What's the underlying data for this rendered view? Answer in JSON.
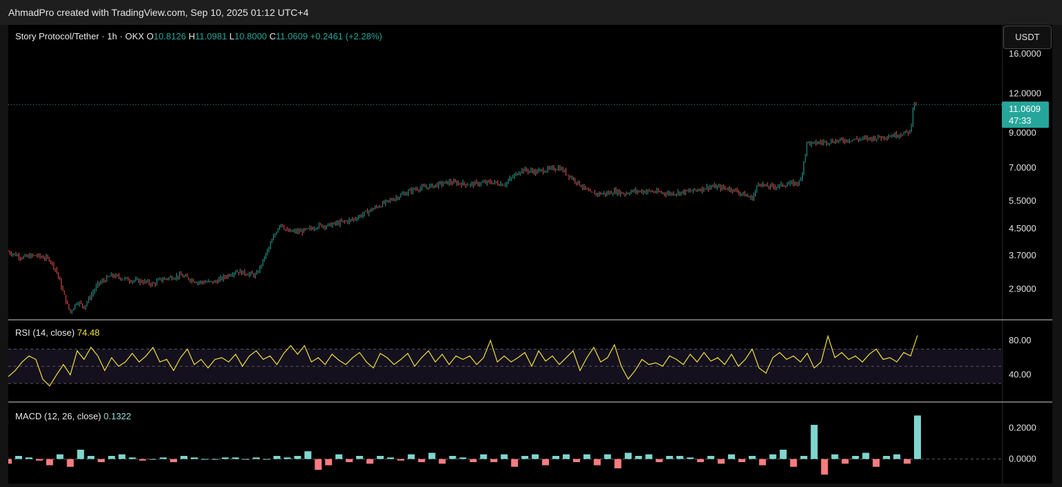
{
  "header": {
    "attribution": "AhmadPro created with TradingView.com, Sep 10, 2025 01:12 UTC+4"
  },
  "symbol": {
    "name": "Story Protocol/Tether · 1h · OKX",
    "open_label": "O",
    "open": "10.8126",
    "high_label": "H",
    "high": "11.0981",
    "low_label": "L",
    "low": "10.8000",
    "close_label": "C",
    "close": "11.0609",
    "change": "+0.2461 (+2.28%)"
  },
  "currency_button": "USDT",
  "last_price": {
    "value": "11.0609",
    "countdown": "47:33"
  },
  "colors": {
    "up": "#26a69a",
    "down": "#ef5350",
    "rsi": "#f5e13a",
    "hist_up": "#7fd6cf",
    "hist_down": "#f77c80"
  },
  "chart_data": [
    {
      "type": "line",
      "title": "Story Protocol/Tether · 1h · OKX",
      "scale": "log",
      "y_ticks": [
        "16.0000",
        "12.0000",
        "9.0000",
        "7.0000",
        "5.5000",
        "4.5000",
        "3.7000",
        "2.9000"
      ],
      "ylim": [
        2.4,
        17
      ],
      "x": [
        0,
        20,
        40,
        60,
        70,
        85,
        90,
        100,
        110,
        130,
        150,
        175,
        200,
        210,
        220,
        250,
        275,
        300,
        330,
        360,
        395,
        405,
        425,
        440,
        450,
        465,
        500,
        530,
        560,
        590,
        610,
        640,
        670,
        700,
        720,
        745,
        765,
        800,
        830,
        845,
        870,
        880,
        895,
        905,
        930,
        960,
        990,
        1020,
        1050,
        1080,
        1090,
        1100,
        1110,
        1130,
        1150,
        1160,
        1165,
        1175,
        1200,
        1230,
        1260,
        1290,
        1300,
        1310,
        1314,
        1320
      ],
      "values": [
        3.8,
        3.65,
        3.7,
        3.6,
        3.3,
        2.6,
        2.45,
        2.65,
        2.55,
        3.0,
        3.2,
        3.1,
        3.05,
        3.0,
        3.1,
        3.2,
        3.05,
        3.05,
        3.3,
        3.2,
        4.7,
        4.4,
        4.4,
        4.5,
        4.6,
        4.6,
        4.8,
        5.2,
        5.6,
        6.0,
        6.1,
        6.3,
        6.2,
        6.3,
        6.2,
        6.9,
        6.8,
        7.0,
        6.2,
        5.8,
        5.8,
        5.9,
        5.8,
        5.9,
        5.9,
        5.8,
        5.9,
        6.1,
        6.0,
        5.6,
        6.3,
        6.1,
        6.1,
        6.2,
        6.3,
        8.5,
        8.3,
        8.4,
        8.5,
        8.6,
        8.7,
        8.9,
        9.0,
        9.1,
        11.2,
        11.06
      ],
      "last_value": 11.0609
    },
    {
      "type": "line",
      "title": "RSI (14, close)",
      "latest": "74.48",
      "y_ticks": [
        "80.00",
        "40.00"
      ],
      "bands": [
        30,
        50,
        70
      ],
      "ylim": [
        10,
        100
      ],
      "x": [
        0,
        10,
        20,
        30,
        40,
        50,
        60,
        70,
        80,
        90,
        100,
        110,
        120,
        130,
        140,
        150,
        160,
        170,
        180,
        190,
        200,
        210,
        220,
        230,
        240,
        250,
        260,
        270,
        280,
        290,
        300,
        310,
        320,
        330,
        340,
        350,
        360,
        370,
        380,
        390,
        400,
        410,
        420,
        430,
        440,
        450,
        460,
        470,
        480,
        490,
        500,
        510,
        520,
        530,
        540,
        550,
        560,
        570,
        580,
        590,
        600,
        610,
        620,
        630,
        640,
        650,
        660,
        670,
        680,
        690,
        700,
        710,
        720,
        730,
        740,
        750,
        760,
        770,
        780,
        790,
        800,
        810,
        820,
        830,
        840,
        850,
        860,
        870,
        880,
        890,
        900,
        910,
        920,
        930,
        940,
        950,
        960,
        970,
        980,
        990,
        1000,
        1010,
        1020,
        1030,
        1040,
        1050,
        1060,
        1070,
        1080,
        1090,
        1100,
        1110,
        1120,
        1130,
        1140,
        1150,
        1160,
        1170,
        1180,
        1190,
        1200,
        1210,
        1220,
        1230,
        1240,
        1250,
        1260,
        1270,
        1280,
        1290,
        1300,
        1310,
        1320
      ],
      "values": [
        38,
        45,
        55,
        62,
        58,
        35,
        27,
        40,
        52,
        40,
        68,
        58,
        72,
        62,
        45,
        60,
        50,
        55,
        65,
        55,
        62,
        72,
        55,
        58,
        45,
        60,
        70,
        52,
        58,
        48,
        58,
        60,
        55,
        64,
        50,
        62,
        68,
        58,
        62,
        52,
        65,
        74,
        64,
        74,
        55,
        60,
        52,
        64,
        57,
        52,
        60,
        66,
        55,
        48,
        65,
        60,
        52,
        58,
        65,
        50,
        60,
        68,
        55,
        64,
        52,
        62,
        58,
        62,
        52,
        60,
        80,
        55,
        62,
        55,
        60,
        66,
        50,
        68,
        56,
        62,
        52,
        60,
        68,
        45,
        60,
        72,
        55,
        60,
        75,
        50,
        35,
        45,
        58,
        52,
        54,
        50,
        62,
        58,
        52,
        64,
        55,
        66,
        56,
        60,
        52,
        64,
        50,
        58,
        70,
        48,
        42,
        60,
        66,
        58,
        62,
        55,
        65,
        48,
        55,
        85,
        60,
        66,
        58,
        62,
        55,
        64,
        70,
        58,
        60,
        55,
        66,
        62,
        86
      ],
      "last_value": 74.48
    },
    {
      "type": "bar",
      "title": "MACD (12, 26, close)",
      "latest": "0.1322",
      "y_ticks": [
        "0.2000",
        "0.0000"
      ],
      "ylim": [
        -0.14,
        0.34
      ],
      "x": [
        0,
        15,
        30,
        45,
        60,
        75,
        90,
        105,
        120,
        135,
        150,
        165,
        180,
        195,
        210,
        225,
        240,
        255,
        270,
        285,
        300,
        315,
        330,
        345,
        360,
        375,
        390,
        405,
        420,
        435,
        450,
        465,
        480,
        495,
        510,
        525,
        540,
        555,
        570,
        585,
        600,
        615,
        630,
        645,
        660,
        675,
        690,
        705,
        720,
        735,
        750,
        765,
        780,
        795,
        810,
        825,
        840,
        855,
        870,
        885,
        900,
        915,
        930,
        945,
        960,
        975,
        990,
        1005,
        1020,
        1035,
        1050,
        1065,
        1080,
        1095,
        1110,
        1125,
        1140,
        1155,
        1170,
        1185,
        1200,
        1215,
        1230,
        1245,
        1260,
        1275,
        1290,
        1305,
        1320
      ],
      "values": [
        -0.03,
        0.02,
        0.01,
        -0.01,
        -0.04,
        0.03,
        -0.05,
        0.06,
        0.02,
        -0.02,
        0.02,
        0.03,
        0.01,
        -0.01,
        0.0,
        0.01,
        -0.02,
        0.02,
        0.01,
        0.0,
        0.0,
        0.01,
        0.01,
        0.0,
        0.01,
        0.0,
        0.02,
        0.01,
        0.02,
        0.05,
        -0.07,
        -0.04,
        0.03,
        -0.02,
        0.02,
        -0.03,
        0.02,
        0.01,
        -0.01,
        0.03,
        -0.02,
        0.04,
        -0.03,
        0.02,
        0.01,
        -0.02,
        0.03,
        -0.02,
        0.03,
        -0.05,
        0.02,
        0.03,
        -0.04,
        0.02,
        0.03,
        -0.02,
        0.03,
        -0.04,
        0.03,
        -0.06,
        0.04,
        0.02,
        0.03,
        -0.02,
        0.02,
        0.02,
        0.01,
        -0.02,
        0.02,
        -0.03,
        0.03,
        -0.02,
        0.02,
        -0.04,
        0.03,
        0.06,
        -0.05,
        0.02,
        0.22,
        -0.1,
        0.03,
        -0.03,
        0.02,
        0.04,
        -0.05,
        0.02,
        0.03,
        -0.03,
        0.28
      ],
      "last_value": 0.1322
    }
  ]
}
